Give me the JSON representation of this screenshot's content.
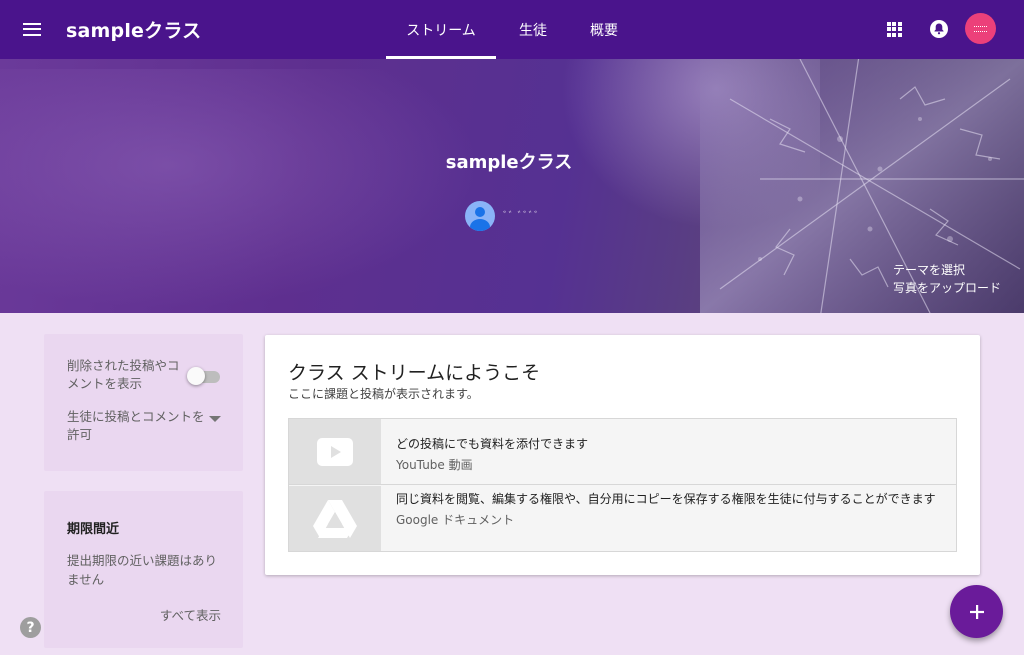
{
  "header": {
    "menu_icon": "hamburger-menu-icon",
    "class_title": "sampleクラス",
    "tabs": [
      {
        "label": "ストリーム",
        "active": true
      },
      {
        "label": "生徒",
        "active": false
      },
      {
        "label": "概要",
        "active": false
      }
    ],
    "apps_icon": "apps-grid-icon",
    "notification_icon": "bell-icon",
    "account_icon": "account-avatar-icon",
    "brand_color": "#4a148c"
  },
  "banner": {
    "class_name": "sampleクラス",
    "teacher_avatar_icon": "person-avatar-icon",
    "teacher_name": "ﾞﾞ ﾞﾞﾞﾞ",
    "theme_link": "テーマを選択",
    "photo_link": "写真をアップロード"
  },
  "sidebar": {
    "settings": {
      "show_deleted_label": "削除された投稿やコメントを表示",
      "show_deleted_enabled": false,
      "permission_label": "生徒に投稿とコメントを許可"
    },
    "upcoming": {
      "title": "期限間近",
      "empty_text": "提出期限の近い課題はありません",
      "view_all": "すべて表示"
    }
  },
  "welcome": {
    "title": "クラス ストリームにようこそ",
    "subtitle": "ここに課題と投稿が表示されます。",
    "features": [
      {
        "icon": "youtube-play-icon",
        "text": "どの投稿にでも資料を添付できます",
        "source": "YouTube 動画"
      },
      {
        "icon": "google-drive-icon",
        "text": "同じ資料を閲覧、編集する権限や、自分用にコピーを保存する権限を生徒に付与することができます",
        "source": "Google ドキュメント"
      }
    ]
  },
  "floating": {
    "help_label": "?",
    "help_icon": "help-icon",
    "add_icon": "add-icon",
    "fab_color": "#6a1b9a"
  }
}
